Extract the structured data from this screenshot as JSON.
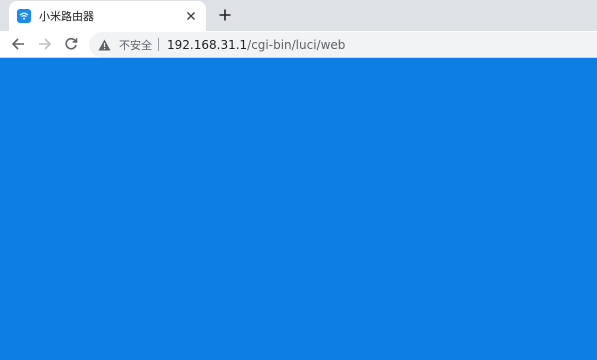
{
  "tab": {
    "title": "小米路由器",
    "favicon": "wifi-icon",
    "close": "close-icon"
  },
  "new_tab": "plus-icon",
  "toolbar": {
    "back": "arrow-left-icon",
    "forward": "arrow-right-icon",
    "reload": "reload-icon"
  },
  "omnibox": {
    "security_icon": "warning-icon",
    "security_label": "不安全",
    "url_host": "192.168.31.1",
    "url_path": "/cgi-bin/luci/web"
  },
  "page": {
    "background_color": "#0d7fe4"
  },
  "colors": {
    "tabstrip": "#dee1e6",
    "favicon": "#1a8cf0",
    "omnibox": "#f1f3f4"
  }
}
